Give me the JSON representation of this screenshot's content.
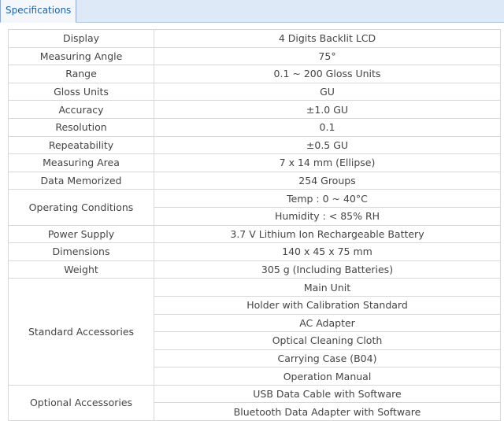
{
  "tab": {
    "label": "Specifications"
  },
  "specs": [
    {
      "label": "Display",
      "values": [
        "4 Digits Backlit LCD"
      ]
    },
    {
      "label": "Measuring Angle",
      "values": [
        "75°"
      ]
    },
    {
      "label": "Range",
      "values": [
        "0.1 ~ 200 Gloss Units"
      ]
    },
    {
      "label": "Gloss Units",
      "values": [
        "GU"
      ]
    },
    {
      "label": "Accuracy",
      "values": [
        "±1.0 GU"
      ]
    },
    {
      "label": "Resolution",
      "values": [
        "0.1"
      ]
    },
    {
      "label": "Repeatability",
      "values": [
        "±0.5 GU"
      ]
    },
    {
      "label": "Measuring Area",
      "values": [
        "7 x 14 mm (Ellipse)"
      ]
    },
    {
      "label": "Data Memorized",
      "values": [
        "254 Groups"
      ]
    },
    {
      "label": "Operating Conditions",
      "values": [
        "Temp : 0 ~ 40°C",
        "Humidity : < 85% RH"
      ]
    },
    {
      "label": "Power Supply",
      "values": [
        "3.7 V Lithium Ion Rechargeable Battery"
      ]
    },
    {
      "label": "Dimensions",
      "values": [
        "140 x 45 x 75 mm"
      ]
    },
    {
      "label": "Weight",
      "values": [
        "305 g (Including Batteries)"
      ]
    },
    {
      "label": "Standard Accessories",
      "values": [
        "Main Unit",
        "Holder with Calibration Standard",
        "AC Adapter",
        "Optical Cleaning Cloth",
        "Carrying Case (B04)",
        "Operation Manual"
      ]
    },
    {
      "label": "Optional Accessories",
      "values": [
        "USB Data Cable with Software",
        "Bluetooth Data Adapter with Software"
      ]
    }
  ]
}
